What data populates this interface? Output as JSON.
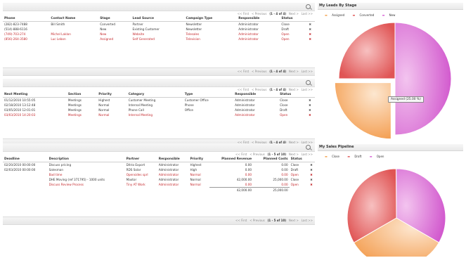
{
  "pager_top": {
    "first": "<< First",
    "prev": "< Previous",
    "range": "(1 - 4 of 4)",
    "next": "Next >",
    "last": "Last >>"
  },
  "leads": {
    "columns": [
      "Phone",
      "Contact Name",
      "Stage",
      "Lead Source",
      "Campaign Type",
      "Responsible",
      "Status",
      ""
    ],
    "rows": [
      {
        "red": false,
        "cells": [
          "(282)-823-7488",
          "Bill Smith",
          "Converted",
          "Partner",
          "Newsletter",
          "Administrator",
          "Close",
          "✖"
        ]
      },
      {
        "red": false,
        "cells": [
          "(514)-888-6116",
          "",
          "New",
          "Existing Customer",
          "Newsletter",
          "Administrator",
          "Draft",
          "✖"
        ]
      },
      {
        "red": true,
        "cells": [
          "(749)-703-274",
          "Michel Laklon",
          "New",
          "Website",
          "Telesales",
          "Administrator",
          "Open",
          "✖"
        ]
      },
      {
        "red": true,
        "cells": [
          "(856)-264-3580",
          "Luc Lebon",
          "Assigned",
          "Self Generated",
          "Television",
          "Administrator",
          "Open",
          "✖"
        ]
      }
    ],
    "pager": {
      "first": "<< First",
      "prev": "< Previous",
      "range": "(1 - 4 of 4)",
      "next": "Next >",
      "last": "Last >>"
    }
  },
  "meetings": {
    "pager_top": {
      "first": "<< First",
      "prev": "< Previous",
      "range": "(1 - 4 of 4)",
      "next": "Next >",
      "last": "Last >>"
    },
    "columns": [
      "Next Meeting",
      "Section",
      "Priority",
      "Category",
      "Type",
      "Responsible",
      "Status",
      ""
    ],
    "rows": [
      {
        "red": false,
        "cells": [
          "01/12/2010 10:55:05",
          "Meetings",
          "Highest",
          "Customer Meeting",
          "Customer Office",
          "Administrator",
          "Close",
          "✖"
        ]
      },
      {
        "red": false,
        "cells": [
          "02/18/2010 13:12:48",
          "Meetings",
          "Normal",
          "Internal Meeting",
          "Phone",
          "Administrator",
          "Close",
          "✖"
        ]
      },
      {
        "red": false,
        "cells": [
          "03/05/2010 12:01:01",
          "Meetings",
          "Normal",
          "Phone Call",
          "Office",
          "Administrator",
          "Draft",
          "✖"
        ]
      },
      {
        "red": true,
        "cells": [
          "03/03/2010 14:20:03",
          "Meetings",
          "Normal",
          "Internal Meeting",
          "",
          "Administrator",
          "Open",
          "✖"
        ]
      }
    ],
    "pager": {
      "first": "<< First",
      "prev": "< Previous",
      "range": "(1 - 4 of 4)",
      "next": "Next >",
      "last": "Last >>"
    }
  },
  "opportunities": {
    "pager_top": {
      "first": "<< First",
      "prev": "< Previous",
      "range": "(1 - 5 of 10)",
      "next": "Next >",
      "last": "Last >>"
    },
    "columns": [
      "Deadline",
      "Description",
      "Partner",
      "Responsible",
      "Priority",
      "Planned Revenue",
      "Planned Costs",
      "Status",
      ""
    ],
    "rows": [
      {
        "red": false,
        "cells": [
          "02/20/2010 00:00:00",
          "Discuss pricing",
          "Ditrio Export",
          "Administrator",
          "Highest",
          "0.00",
          "0.00",
          "Close",
          "✖"
        ]
      },
      {
        "red": false,
        "cells": [
          "02/03/2010 00:00:00",
          "Salesman",
          "RDS Solar",
          "Administrator",
          "High",
          "0.00",
          "0.00",
          "Draft",
          "✖"
        ]
      },
      {
        "red": true,
        "cells": [
          "",
          "Bad time",
          "Opensides sprl",
          "Administrator",
          "Normal",
          "0.00",
          "0.00",
          "Open",
          "✖"
        ]
      },
      {
        "red": false,
        "cells": [
          "",
          "DHE Moving (ref 371795) - 1000 units",
          "Maxtor",
          "Administrator",
          "Normal",
          "42,000.00",
          "25,000.00",
          "Close",
          "✖"
        ]
      },
      {
        "red": true,
        "cells": [
          "",
          "Discuss Review Process",
          "Tiny AT Work",
          "Administrator",
          "Normal",
          "0.00",
          "0.00",
          "Open",
          "✖"
        ]
      }
    ],
    "totals": {
      "revenue": "42,000.00",
      "costs": "25,000.00"
    },
    "pager": {
      "first": "<< First",
      "prev": "< Previous",
      "range": "(1 - 5 of 10)",
      "next": "Next >",
      "last": "Last >>"
    }
  },
  "leads_chart": {
    "title": "My Leads By Stage",
    "legend": [
      {
        "label": "Assigned",
        "color": "#f4a24e"
      },
      {
        "label": "Converted",
        "color": "#e05a5a"
      },
      {
        "label": "New",
        "color": "#d966d6"
      }
    ],
    "tooltip": "Assigned (25.00 %)"
  },
  "pipeline_chart": {
    "title": "My Sales Pipeline",
    "legend": [
      {
        "label": "Close",
        "color": "#f4a24e"
      },
      {
        "label": "Draft",
        "color": "#e05a5a"
      },
      {
        "label": "Open",
        "color": "#d966d6"
      }
    ]
  },
  "chart_data": [
    {
      "type": "pie",
      "title": "My Leads By Stage",
      "categories": [
        "Assigned",
        "Converted",
        "New"
      ],
      "values": [
        25,
        25,
        50
      ]
    },
    {
      "type": "pie",
      "title": "My Sales Pipeline",
      "categories": [
        "Close",
        "Draft",
        "Open"
      ],
      "values": [
        33.3,
        33.3,
        33.4
      ]
    }
  ]
}
